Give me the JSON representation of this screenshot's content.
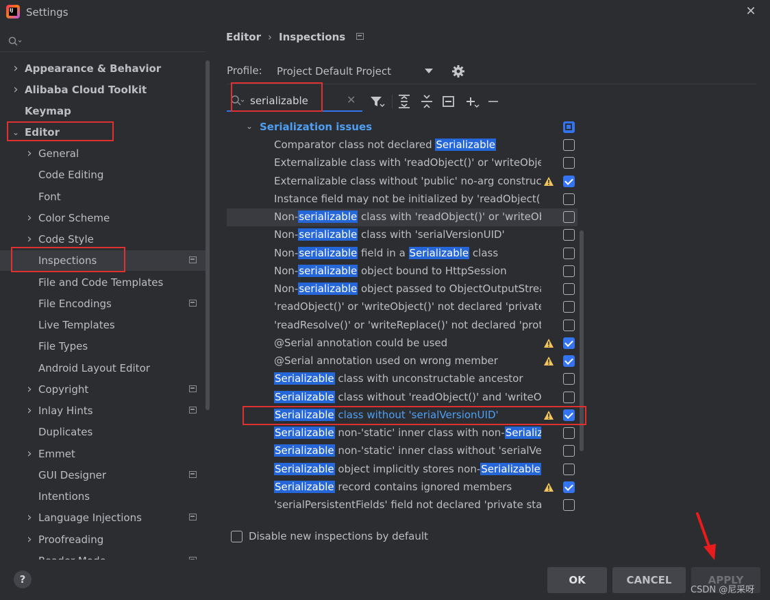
{
  "window": {
    "title": "Settings",
    "logo_text": "IJ"
  },
  "sidebar": {
    "items": [
      {
        "label": "Appearance & Behavior",
        "bold": true,
        "arrow": "right",
        "indent": 0
      },
      {
        "label": "Alibaba Cloud Toolkit",
        "bold": true,
        "arrow": "right",
        "indent": 0
      },
      {
        "label": "Keymap",
        "bold": true,
        "arrow": "",
        "indent": 0
      },
      {
        "label": "Editor",
        "bold": true,
        "arrow": "down",
        "indent": 0
      },
      {
        "label": "General",
        "arrow": "right",
        "indent": 1
      },
      {
        "label": "Code Editing",
        "arrow": "",
        "indent": 1
      },
      {
        "label": "Font",
        "arrow": "",
        "indent": 1
      },
      {
        "label": "Color Scheme",
        "arrow": "right",
        "indent": 1
      },
      {
        "label": "Code Style",
        "arrow": "right",
        "indent": 1
      },
      {
        "label": "Inspections",
        "arrow": "",
        "indent": 1,
        "selected": true,
        "project": true
      },
      {
        "label": "File and Code Templates",
        "arrow": "",
        "indent": 1
      },
      {
        "label": "File Encodings",
        "arrow": "",
        "indent": 1,
        "project": true
      },
      {
        "label": "Live Templates",
        "arrow": "",
        "indent": 1
      },
      {
        "label": "File Types",
        "arrow": "",
        "indent": 1
      },
      {
        "label": "Android Layout Editor",
        "arrow": "",
        "indent": 1
      },
      {
        "label": "Copyright",
        "arrow": "right",
        "indent": 1,
        "project": true
      },
      {
        "label": "Inlay Hints",
        "arrow": "right",
        "indent": 1,
        "project": true
      },
      {
        "label": "Duplicates",
        "arrow": "",
        "indent": 1
      },
      {
        "label": "Emmet",
        "arrow": "right",
        "indent": 1
      },
      {
        "label": "GUI Designer",
        "arrow": "",
        "indent": 1,
        "project": true
      },
      {
        "label": "Intentions",
        "arrow": "",
        "indent": 1
      },
      {
        "label": "Language Injections",
        "arrow": "right",
        "indent": 1,
        "project": true
      },
      {
        "label": "Proofreading",
        "arrow": "right",
        "indent": 1
      },
      {
        "label": "Reader Mode",
        "arrow": "",
        "indent": 1,
        "project": true
      }
    ]
  },
  "breadcrumb": {
    "parent": "Editor",
    "separator": "›",
    "current": "Inspections"
  },
  "profile": {
    "label": "Profile:",
    "value": "Project Default  Project"
  },
  "filter": {
    "value": "serializable",
    "placeholder": ""
  },
  "group": {
    "label": "Serialization issues",
    "state": "mixed"
  },
  "inspections": [
    {
      "segments": [
        [
          "Comparator class not declared ",
          false
        ],
        [
          "Serializable",
          true
        ]
      ],
      "warn": false,
      "checked": false
    },
    {
      "segments": [
        [
          "Externalizable class with 'readObject()' or 'writeObject()' method",
          false
        ]
      ],
      "warn": false,
      "checked": false
    },
    {
      "segments": [
        [
          "Externalizable class without 'public' no-arg constructor",
          false
        ]
      ],
      "warn": true,
      "checked": true
    },
    {
      "segments": [
        [
          "Instance field may not be initialized by 'readObject()'",
          false
        ]
      ],
      "warn": false,
      "checked": false
    },
    {
      "segments": [
        [
          "Non-",
          false
        ],
        [
          "serializable",
          true
        ],
        [
          " class with 'readObject()' or 'writeObject()'",
          false
        ]
      ],
      "warn": false,
      "checked": false,
      "hover": true
    },
    {
      "segments": [
        [
          "Non-",
          false
        ],
        [
          "serializable",
          true
        ],
        [
          " class with 'serialVersionUID'",
          false
        ]
      ],
      "warn": false,
      "checked": false
    },
    {
      "segments": [
        [
          "Non-",
          false
        ],
        [
          "serializable",
          true
        ],
        [
          " field in a ",
          false
        ],
        [
          "Serializable",
          true
        ],
        [
          " class",
          false
        ]
      ],
      "warn": false,
      "checked": false
    },
    {
      "segments": [
        [
          "Non-",
          false
        ],
        [
          "serializable",
          true
        ],
        [
          " object bound to HttpSession",
          false
        ]
      ],
      "warn": false,
      "checked": false
    },
    {
      "segments": [
        [
          "Non-",
          false
        ],
        [
          "serializable",
          true
        ],
        [
          " object passed to ObjectOutputStream",
          false
        ]
      ],
      "warn": false,
      "checked": false
    },
    {
      "segments": [
        [
          "'readObject()' or 'writeObject()' not declared 'private'",
          false
        ]
      ],
      "warn": false,
      "checked": false
    },
    {
      "segments": [
        [
          "'readResolve()' or 'writeReplace()' not declared 'protected'",
          false
        ]
      ],
      "warn": false,
      "checked": false
    },
    {
      "segments": [
        [
          "@Serial annotation could be used",
          false
        ]
      ],
      "warn": true,
      "checked": true
    },
    {
      "segments": [
        [
          "@Serial annotation used on wrong member",
          false
        ]
      ],
      "warn": true,
      "checked": true
    },
    {
      "segments": [
        [
          "Serializable",
          true
        ],
        [
          " class with unconstructable ancestor",
          false
        ]
      ],
      "warn": false,
      "checked": false
    },
    {
      "segments": [
        [
          "Serializable",
          true
        ],
        [
          " class without 'readObject()' and 'writeObject()'",
          false
        ]
      ],
      "warn": false,
      "checked": false
    },
    {
      "segments": [
        [
          "Serializable",
          true
        ],
        [
          " class without 'serialVersionUID'",
          false
        ]
      ],
      "warn": true,
      "checked": true,
      "highlighted": true
    },
    {
      "segments": [
        [
          "Serializable",
          true
        ],
        [
          " non-'static' inner class with non-",
          false
        ],
        [
          "Serializable",
          true
        ],
        [
          " outer class",
          false
        ]
      ],
      "warn": false,
      "checked": false
    },
    {
      "segments": [
        [
          "Serializable",
          true
        ],
        [
          " non-'static' inner class without 'serialVersionUID'",
          false
        ]
      ],
      "warn": false,
      "checked": false
    },
    {
      "segments": [
        [
          "Serializable",
          true
        ],
        [
          " object implicitly stores non-",
          false
        ],
        [
          "Serializable",
          true
        ],
        [
          " objects",
          false
        ]
      ],
      "warn": false,
      "checked": false
    },
    {
      "segments": [
        [
          "Serializable",
          true
        ],
        [
          " record contains ignored members",
          false
        ]
      ],
      "warn": true,
      "checked": true
    },
    {
      "segments": [
        [
          "'serialPersistentFields' field not declared 'private static final'",
          false
        ]
      ],
      "warn": false,
      "checked": false
    }
  ],
  "bottom_option": {
    "label": "Disable new inspections by default",
    "checked": false
  },
  "buttons": {
    "ok": "OK",
    "cancel": "CANCEL",
    "apply": "APPLY"
  },
  "help": "?",
  "watermark": "CSDN @尼采呀",
  "colors": {
    "accent": "#3574f0",
    "highlight_bg": "#2566d8",
    "annotation_red": "#e03030",
    "group_label": "#4e9ff4",
    "warning": "#f2c55c"
  }
}
